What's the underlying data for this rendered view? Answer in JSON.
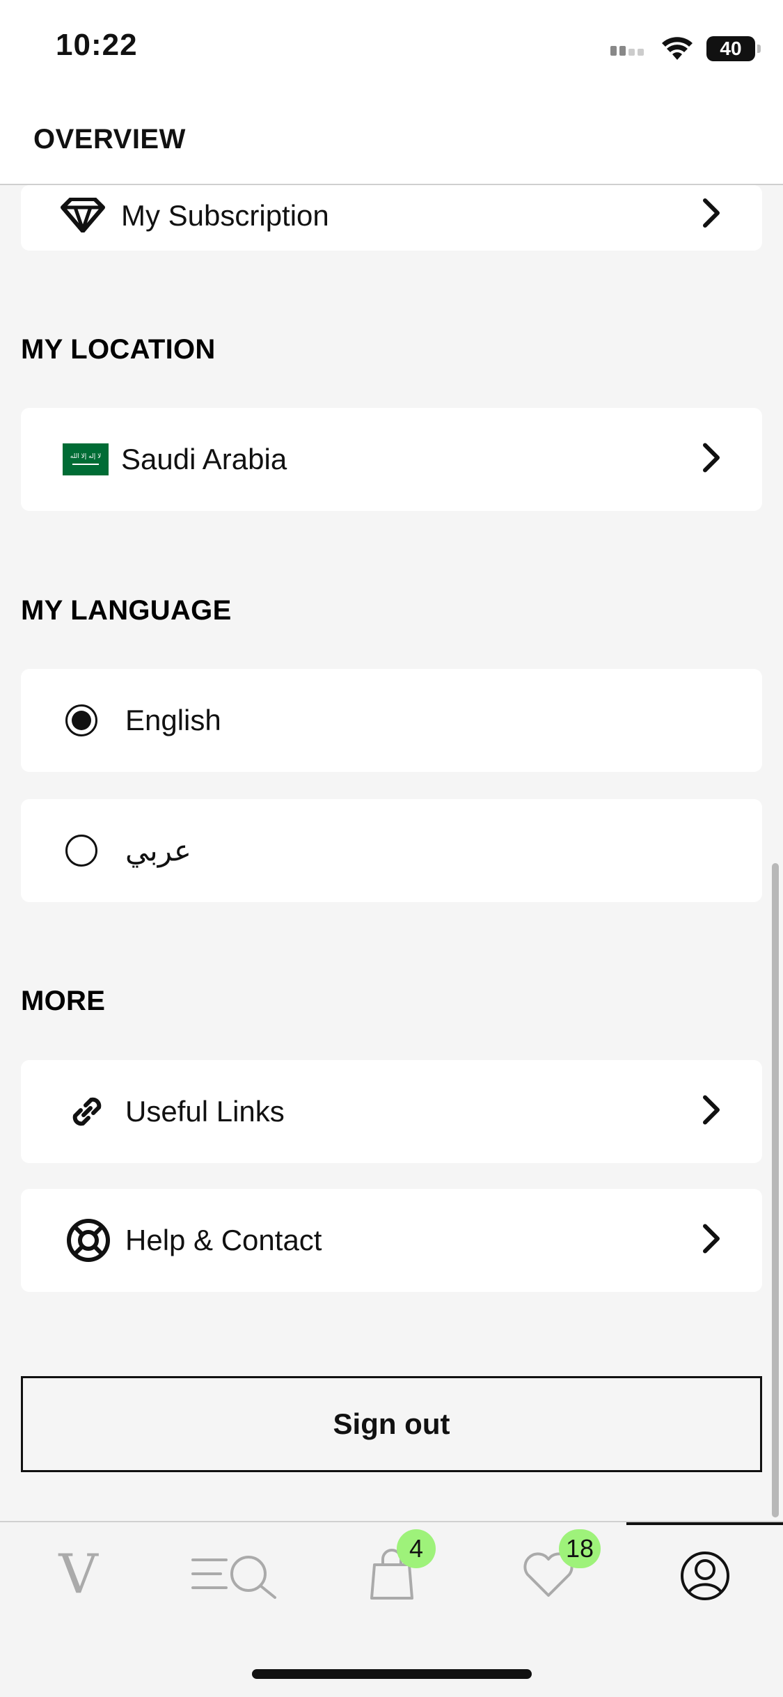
{
  "status_bar": {
    "time": "10:22",
    "battery": "40"
  },
  "header": {
    "title": "OVERVIEW"
  },
  "subscription": {
    "label": "My Subscription",
    "icon": "diamond-icon"
  },
  "location": {
    "section_title": "MY LOCATION",
    "country": "Saudi Arabia",
    "flag_text": "لا إله إلا الله"
  },
  "language": {
    "section_title": "MY LANGUAGE",
    "options": [
      {
        "label": "English",
        "selected": true
      },
      {
        "label": "عربي",
        "selected": false
      }
    ]
  },
  "more": {
    "section_title": "MORE",
    "items": [
      {
        "label": "Useful Links",
        "icon": "link-icon"
      },
      {
        "label": "Help & Contact",
        "icon": "lifebuoy-icon"
      }
    ]
  },
  "sign_out": {
    "label": "Sign out"
  },
  "tabbar": {
    "tabs": [
      {
        "name": "home",
        "icon": "logo-v-icon",
        "label": "V"
      },
      {
        "name": "search",
        "icon": "menu-search-icon"
      },
      {
        "name": "bag",
        "icon": "shopping-bag-icon",
        "badge": "4"
      },
      {
        "name": "wishlist",
        "icon": "heart-icon",
        "badge": "18"
      },
      {
        "name": "account",
        "icon": "user-icon",
        "active": true
      }
    ]
  },
  "colors": {
    "badge": "#9ef27a",
    "flag_green": "#006c35",
    "background": "#f5f5f5"
  }
}
